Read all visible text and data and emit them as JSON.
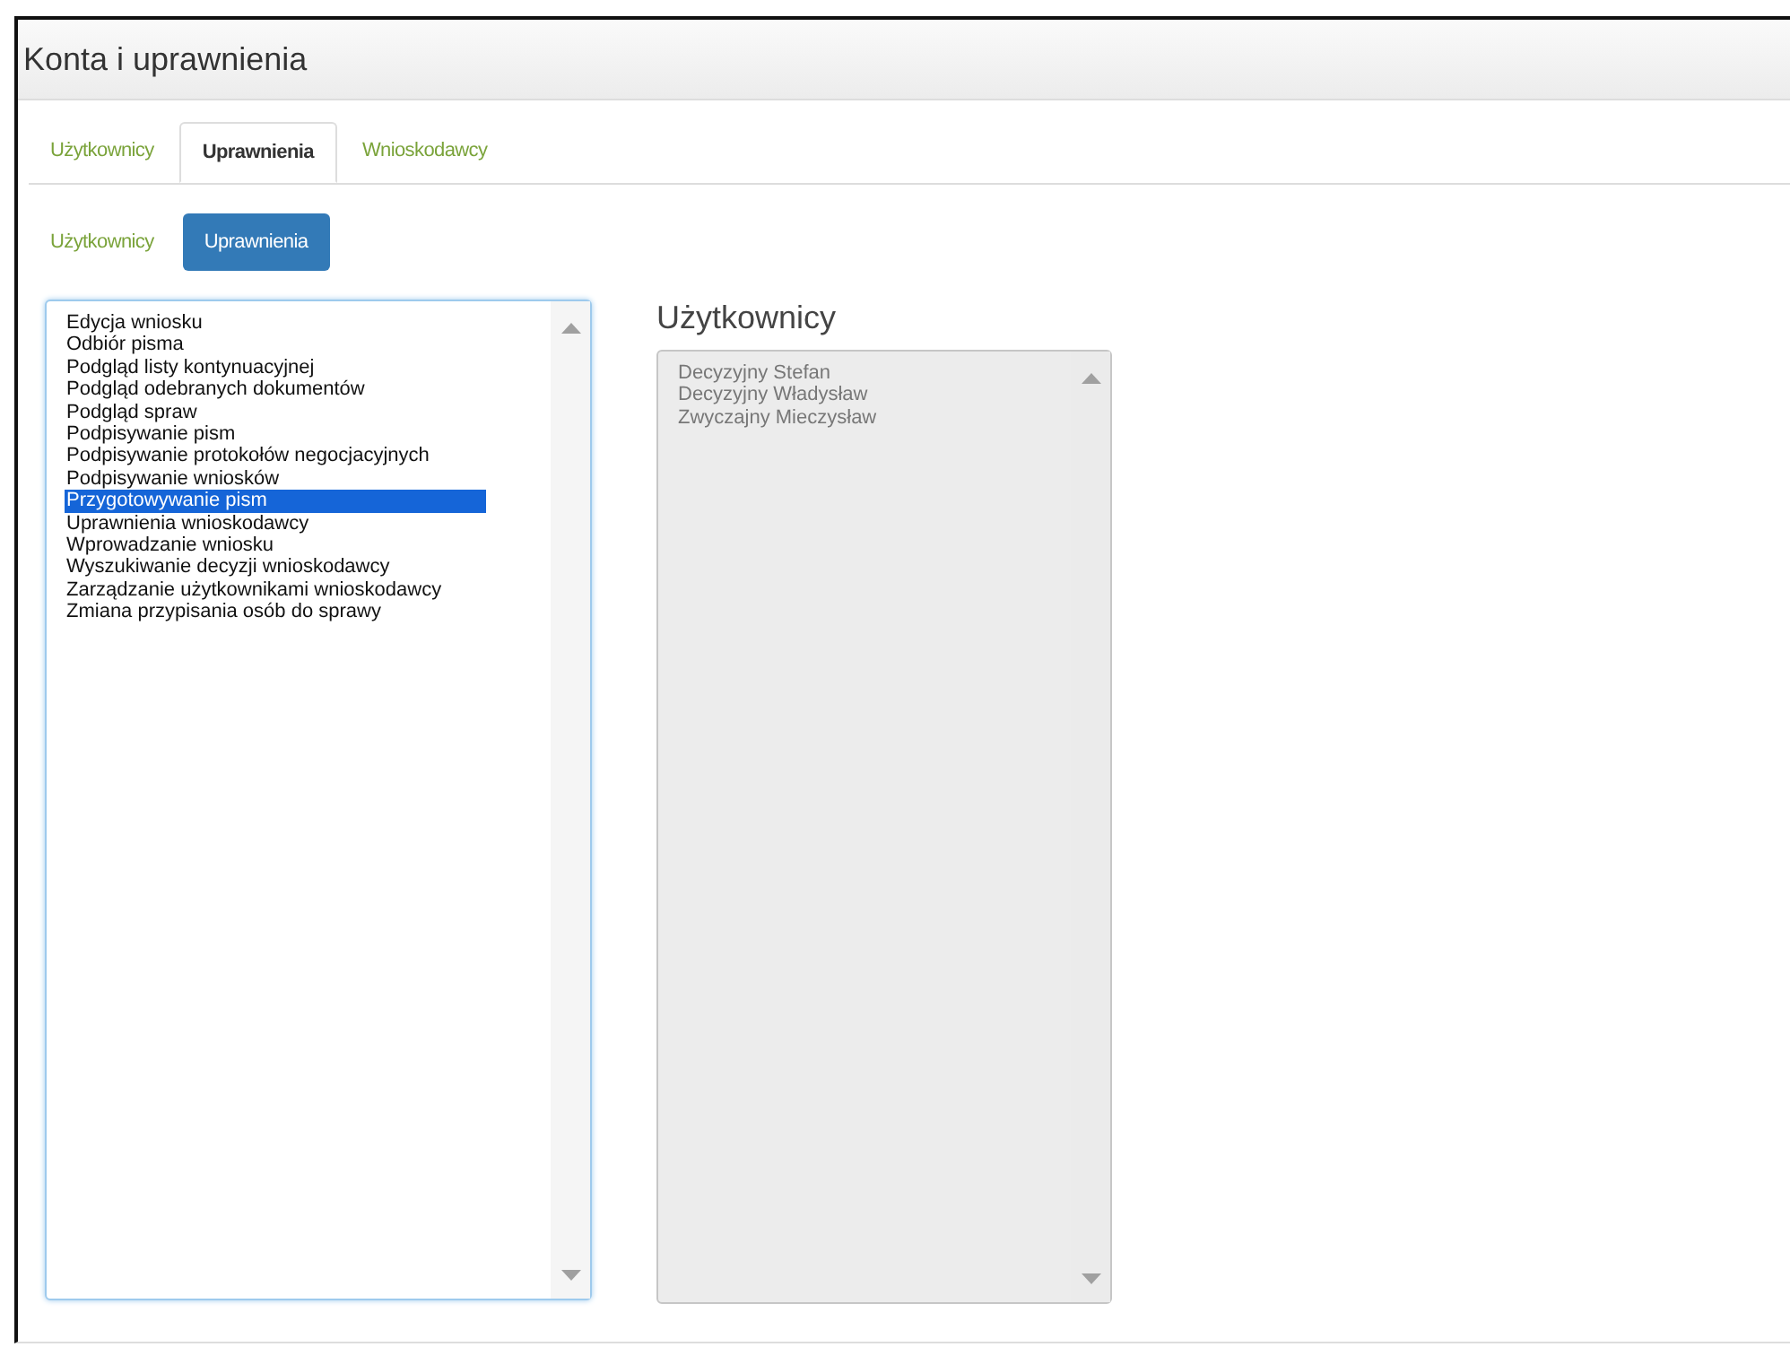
{
  "window": {
    "title": "Konta i uprawnienia"
  },
  "tabs": [
    {
      "label": "Użytkownicy",
      "selected": false
    },
    {
      "label": "Uprawnienia",
      "selected": true
    },
    {
      "label": "Wnioskodawcy",
      "selected": false
    }
  ],
  "pills": [
    {
      "label": "Użytkownicy",
      "selected": false
    },
    {
      "label": "Uprawnienia",
      "selected": true
    }
  ],
  "permissions": {
    "disabled": false,
    "items": [
      {
        "label": "Edycja wniosku",
        "selected": false
      },
      {
        "label": "Odbiór pisma",
        "selected": false
      },
      {
        "label": "Podgląd listy kontynuacyjnej",
        "selected": false
      },
      {
        "label": "Podgląd odebranych dokumentów",
        "selected": false
      },
      {
        "label": "Podgląd spraw",
        "selected": false
      },
      {
        "label": "Podpisywanie pism",
        "selected": false
      },
      {
        "label": "Podpisywanie protokołów negocjacyjnych",
        "selected": false
      },
      {
        "label": "Podpisywanie wniosków",
        "selected": false
      },
      {
        "label": "Przygotowywanie pism",
        "selected": true
      },
      {
        "label": "Uprawnienia wnioskodawcy",
        "selected": false
      },
      {
        "label": "Wprowadzanie wniosku",
        "selected": false
      },
      {
        "label": "Wyszukiwanie decyzji wnioskodawcy",
        "selected": false
      },
      {
        "label": "Zarządzanie użytkownikami wnioskodawcy",
        "selected": false
      },
      {
        "label": "Zmiana przypisania osób do sprawy",
        "selected": false
      }
    ]
  },
  "users": {
    "heading": "Użytkownicy",
    "disabled": true,
    "items": [
      {
        "label": "Decyzyjny Stefan",
        "selected": false
      },
      {
        "label": "Decyzyjny Władysław",
        "selected": false
      },
      {
        "label": "Zwyczajny Mieczysław",
        "selected": false
      }
    ]
  }
}
